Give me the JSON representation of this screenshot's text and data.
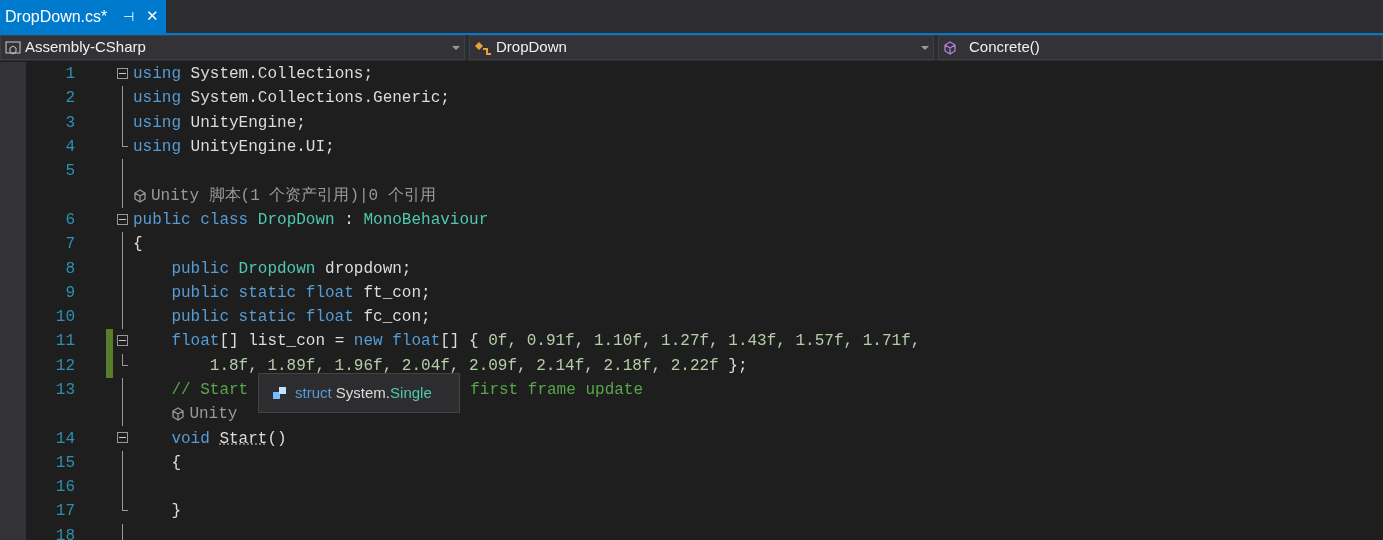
{
  "tab": {
    "title": "DropDown.cs*",
    "pin": "⊣",
    "close": "✕",
    "selected": true
  },
  "navigation": [
    {
      "kind": "project",
      "label": "Assembly-CSharp"
    },
    {
      "kind": "class",
      "label": "DropDown"
    },
    {
      "kind": "member",
      "label": "Concrete()"
    }
  ],
  "lines": [
    {
      "kind": "code",
      "number": "1",
      "collapsible": true,
      "outline_end": false,
      "changed": false,
      "tokens": [
        {
          "kind": "kw",
          "text": "using "
        },
        {
          "kind": "plain",
          "text": "System.Collections;"
        }
      ]
    },
    {
      "kind": "code",
      "number": "2",
      "collapsible": false,
      "outline_end": false,
      "changed": false,
      "tokens": [
        {
          "kind": "kw",
          "text": "using "
        },
        {
          "kind": "plain",
          "text": "System.Collections.Generic;"
        }
      ]
    },
    {
      "kind": "code",
      "number": "3",
      "collapsible": false,
      "outline_end": false,
      "changed": false,
      "tokens": [
        {
          "kind": "kw",
          "text": "using "
        },
        {
          "kind": "plain",
          "text": "UnityEngine;"
        }
      ]
    },
    {
      "kind": "code",
      "number": "4",
      "collapsible": false,
      "outline_end": true,
      "changed": false,
      "tokens": [
        {
          "kind": "kw",
          "text": "using "
        },
        {
          "kind": "plain",
          "text": "UnityEngine.UI;"
        }
      ]
    },
    {
      "kind": "code",
      "number": "5",
      "collapsible": false,
      "outline_end": false,
      "changed": false
    },
    {
      "kind": "lens",
      "text": "Unity 脚本(1 个资产引用)|0 个引用"
    },
    {
      "kind": "code",
      "number": "6",
      "collapsible": true,
      "outline_end": false,
      "changed": false,
      "tokens": [
        {
          "kind": "kw",
          "text": "public class "
        },
        {
          "kind": "type",
          "text": "DropDown "
        },
        {
          "kind": "plain",
          "text": ": "
        },
        {
          "kind": "type",
          "text": "MonoBehaviour"
        }
      ]
    },
    {
      "kind": "code",
      "number": "7",
      "collapsible": false,
      "outline_end": false,
      "changed": false,
      "tokens": [
        {
          "kind": "plain",
          "text": "{"
        }
      ],
      "children": [
        {
          "kind": "code",
          "number": "8",
          "collapsible": false,
          "outline_end": false,
          "changed": false,
          "tokens": [
            {
              "kind": "kw",
              "text": "public "
            },
            {
              "kind": "type",
              "text": "Dropdown "
            },
            {
              "kind": "plain",
              "text": "dropdown;"
            }
          ]
        },
        {
          "kind": "code",
          "number": "9",
          "collapsible": false,
          "outline_end": false,
          "changed": false,
          "tokens": [
            {
              "kind": "kw",
              "text": "public static float "
            },
            {
              "kind": "plain",
              "text": "ft_con;"
            }
          ]
        },
        {
          "kind": "code",
          "number": "10",
          "collapsible": false,
          "outline_end": false,
          "changed": false,
          "tokens": [
            {
              "kind": "kw",
              "text": "public static float "
            },
            {
              "kind": "plain",
              "text": "fc_con;"
            }
          ]
        },
        {
          "kind": "code",
          "number": "11",
          "collapsible": true,
          "outline_end": false,
          "changed": true,
          "tokens": [
            {
              "kind": "kw",
              "text": "float"
            },
            {
              "kind": "plain",
              "text": "[] list_con = "
            },
            {
              "kind": "kw",
              "text": "new float"
            },
            {
              "kind": "plain",
              "text": "[] { "
            },
            {
              "kind": "num",
              "text": "0f, 0.91f, 1.10f, 1.27f, 1.43f, 1.57f, 1.71f,"
            }
          ],
          "children": [
            {
              "kind": "code",
              "number": "12",
              "collapsible": false,
              "outline_end": true,
              "changed": true,
              "tokens": [
                {
                  "kind": "num",
                  "text": "1.8f, 1.89f, 1.96f, 2.04f, 2.09f, 2.14f, 2.18f, 2.22f"
                },
                {
                  "kind": "plain",
                  "text": " };"
                }
              ]
            }
          ]
        },
        {
          "kind": "code",
          "number": "13",
          "collapsible": false,
          "outline_end": false,
          "changed": false,
          "tokens": [
            {
              "kind": "comment",
              "text": "// Start"
            },
            {
              "kind": "comment",
              "text": "first frame update",
              "gap_before": true
            }
          ]
        },
        {
          "kind": "lens",
          "text": "Unity"
        },
        {
          "kind": "code",
          "number": "14",
          "collapsible": true,
          "outline_end": false,
          "changed": false,
          "tokens": [
            {
              "kind": "kw",
              "text": "void "
            },
            {
              "kind": "method",
              "text": "Start"
            },
            {
              "kind": "plain",
              "text": "()"
            }
          ]
        },
        {
          "kind": "code",
          "number": "15",
          "collapsible": false,
          "outline_end": false,
          "changed": false,
          "tokens": [
            {
              "kind": "plain",
              "text": "{"
            }
          ]
        },
        {
          "kind": "code",
          "number": "16",
          "collapsible": false,
          "outline_end": false,
          "changed": false
        },
        {
          "kind": "code",
          "number": "17",
          "collapsible": false,
          "outline_end": true,
          "changed": false,
          "tokens": [
            {
              "kind": "plain",
              "text": "}"
            }
          ]
        },
        {
          "kind": "code",
          "number": "18",
          "collapsible": false,
          "outline_end": false,
          "changed": false
        }
      ]
    }
  ],
  "tooltip": {
    "keyword": "struct",
    "namespace": "System.",
    "type": "Single"
  }
}
